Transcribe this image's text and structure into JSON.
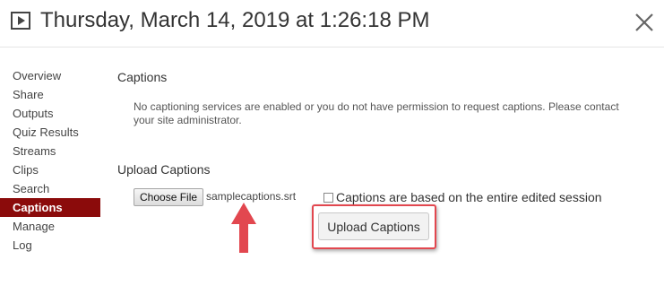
{
  "header": {
    "title": "Thursday, March 14, 2019 at 1:26:18 PM",
    "video_icon": "video-play-icon",
    "close_icon": "close-icon"
  },
  "sidebar": {
    "items": [
      {
        "label": "Overview"
      },
      {
        "label": "Share"
      },
      {
        "label": "Outputs"
      },
      {
        "label": "Quiz Results"
      },
      {
        "label": "Streams"
      },
      {
        "label": "Clips"
      },
      {
        "label": "Search"
      },
      {
        "label": "Captions",
        "active": true
      },
      {
        "label": "Manage"
      },
      {
        "label": "Log"
      }
    ]
  },
  "captions": {
    "heading": "Captions",
    "notice": "No captioning services are enabled or you do not have permission to request captions. Please contact your site administrator."
  },
  "upload": {
    "heading": "Upload Captions",
    "choose_file_label": "Choose File",
    "file_name": "samplecaptions.srt",
    "checkbox_label": "Captions are based on the entire edited session",
    "checkbox_checked": false,
    "upload_button_label": "Upload Captions"
  },
  "colors": {
    "active_item": "#8b0b0b",
    "annotation": "#e2474f"
  }
}
